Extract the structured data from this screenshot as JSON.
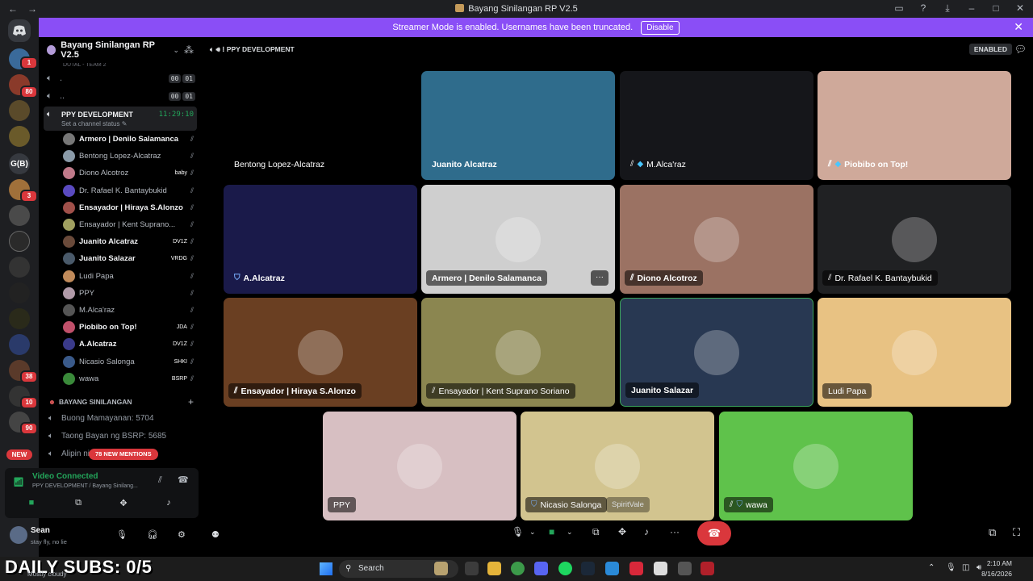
{
  "window": {
    "title": "Bayang Sinilangan RP V2.5"
  },
  "banner": {
    "text": "Streamer Mode is enabled. Usernames have been truncated.",
    "button": "Disable"
  },
  "rail": {
    "gb_label": "G(B)",
    "new_label": "NEW",
    "badges": [
      "1",
      "80",
      "3",
      "38",
      "10",
      "90"
    ]
  },
  "server": {
    "name": "Bayang Sinilangan RP V2.5",
    "cut_text": "DUTAL - TEAM 2"
  },
  "channels": [
    {
      "name": ".",
      "t1": "00",
      "t2": "01"
    },
    {
      "name": "..",
      "t1": "00",
      "t2": "01"
    }
  ],
  "active_channel": {
    "name": "PPY DEVELOPMENT",
    "timer": "11:29:10",
    "status": "Set a channel status"
  },
  "members": [
    {
      "name": "Armero | Denilo Salamanca",
      "bold": true,
      "tag": "",
      "color": "#777"
    },
    {
      "name": "Bentong Lopez-Alcatraz",
      "bold": false,
      "tag": "",
      "color": "#8a9aa8"
    },
    {
      "name": "Diono Alcotroz",
      "bold": false,
      "tag": "baby",
      "color": "#c07a8a"
    },
    {
      "name": "Dr. Rafael K. Bantaybukid",
      "bold": false,
      "tag": "",
      "color": "#5a4ac0"
    },
    {
      "name": "Ensayador | Hiraya S.Alonzo",
      "bold": true,
      "tag": "",
      "color": "#a0504a"
    },
    {
      "name": "Ensayador | Kent Suprano...",
      "bold": false,
      "tag": "",
      "color": "#a0a060"
    },
    {
      "name": "Juanito Alcatraz",
      "bold": true,
      "tag": "DV1Z",
      "color": "#6a4a3a"
    },
    {
      "name": "Juanito Salazar",
      "bold": true,
      "tag": "VRDG",
      "color": "#4a5a6a"
    },
    {
      "name": "Ludi Papa",
      "bold": false,
      "tag": "",
      "color": "#c08a5a"
    },
    {
      "name": "PPY",
      "bold": false,
      "tag": "",
      "color": "#b09aa8"
    },
    {
      "name": "M.Alca'raz",
      "bold": false,
      "tag": "",
      "color": "#555"
    },
    {
      "name": "Piobibo on Top!",
      "bold": true,
      "tag": "JDA",
      "color": "#c0506a"
    },
    {
      "name": "A.Alcatraz",
      "bold": true,
      "tag": "DV1Z",
      "color": "#3a3a8a"
    },
    {
      "name": "Nicasio Salonga",
      "bold": false,
      "tag": "SHKI",
      "color": "#3a5a8a"
    },
    {
      "name": "wawa",
      "bold": false,
      "tag": "BSRP",
      "color": "#3a8a3a"
    }
  ],
  "category": {
    "name": "BAYANG SINILANGAN"
  },
  "voice_channels": [
    "Buong Mamayanan: 5704",
    "Taong Bayan ng BSRP: 5685",
    "Alipin ni Dioney: 19"
  ],
  "mentions": "78 NEW MENTIONS",
  "voice_panel": {
    "status": "Video Connected",
    "sub": "PPY DEVELOPMENT / Bayang Sinilang..."
  },
  "user": {
    "name": "Sean",
    "status": "stay fly, no lie"
  },
  "main_header": {
    "channel": "PPY DEVELOPMENT",
    "enabled": "ENABLED"
  },
  "tiles": [
    {
      "name": "Bentong Lopez-Alcatraz",
      "bold": false,
      "prefix": "",
      "bg": "#000000"
    },
    {
      "name": "Juanito Alcatraz",
      "bold": true,
      "prefix": "",
      "bg": "#2f6c8c"
    },
    {
      "name": "M.Alca'raz",
      "bold": false,
      "prefix": "mute-dia",
      "bg": "#15161a"
    },
    {
      "name": "Piobibo on Top!",
      "bold": true,
      "prefix": "mute-dia",
      "bg": "#cfa99a"
    },
    {
      "name": "A.Alcatraz",
      "bold": true,
      "prefix": "shield",
      "bg": "#1a1a4a"
    },
    {
      "name": "Armero | Denilo Salamanca",
      "bold": true,
      "prefix": "",
      "bg": "#cfcfcf"
    },
    {
      "name": "Diono Alcotroz",
      "bold": true,
      "prefix": "mute",
      "bg": "#9b7263"
    },
    {
      "name": "Dr. Rafael K. Bantaybukid",
      "bold": false,
      "prefix": "mute",
      "bg": "#202123"
    },
    {
      "name": "Ensayador | Hiraya S.Alonzo",
      "bold": true,
      "prefix": "mute",
      "bg": "#6a3f22"
    },
    {
      "name": "Ensayador | Kent Suprano Soriano",
      "bold": false,
      "prefix": "mute",
      "bg": "#8b8650"
    },
    {
      "name": "Juanito Salazar",
      "bold": true,
      "prefix": "",
      "bg": "#283852"
    },
    {
      "name": "Ludi Papa",
      "bold": false,
      "prefix": "",
      "bg": "#e8c283"
    },
    {
      "name": "PPY",
      "bold": false,
      "prefix": "",
      "bg": "#d7bfc2"
    },
    {
      "name": "Nicasio Salonga",
      "bold": false,
      "prefix": "shield",
      "bg": "#d2c48f",
      "chip": "SpiritVale"
    },
    {
      "name": "wawa",
      "bold": false,
      "prefix": "mute-shield",
      "bg": "#5fc24b"
    }
  ],
  "taskbar": {
    "subs": "DAILY SUBS: 0/5",
    "weather": "Mostly cloudy",
    "search": "Search",
    "time": "2:10 AM",
    "date": "8/16/2026"
  }
}
